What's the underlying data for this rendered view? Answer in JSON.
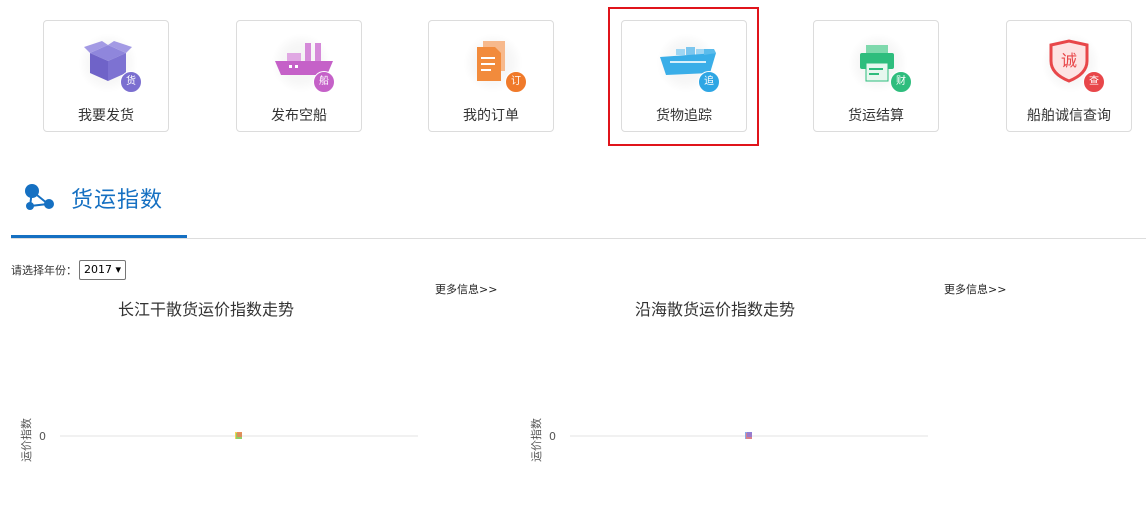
{
  "tiles": [
    {
      "label": "我要发货",
      "badge": "货",
      "icon": "box-icon",
      "color": "#7b6fd0"
    },
    {
      "label": "发布空船",
      "badge": "船",
      "icon": "empty-ship-icon",
      "color": "#c561c8"
    },
    {
      "label": "我的订单",
      "badge": "订",
      "icon": "order-document-icon",
      "color": "#f07a2a"
    },
    {
      "label": "货物追踪",
      "badge": "追",
      "icon": "cargo-ship-icon",
      "color": "#2ea6e4"
    },
    {
      "label": "货运结算",
      "badge": "财",
      "icon": "printer-icon",
      "color": "#2ebd7d"
    },
    {
      "label": "船舶诚信查询",
      "badge": "查",
      "icon": "shield-search-icon",
      "color": "#e8474a"
    }
  ],
  "section": {
    "title": "货运指数",
    "icon": "network-nodes-icon",
    "accent": "#1570c2"
  },
  "year_filter": {
    "label": "请选择年份：",
    "value": "2017"
  },
  "more_link": "更多信息>>",
  "charts": [
    {
      "title": "长江干散货运价指数走势",
      "more": "更多信息>>"
    },
    {
      "title": "沿海散货运价指数走势",
      "more": "更多信息>>"
    }
  ],
  "chart_data": [
    {
      "type": "line",
      "title": "长江干散货运价指数走势",
      "ylabel": "运价指数",
      "xlabel": "",
      "y_ticks": [
        "0"
      ],
      "series": [
        {
          "values": [
            0
          ]
        }
      ]
    },
    {
      "type": "line",
      "title": "沿海散货运价指数走势",
      "ylabel": "运价指数",
      "xlabel": "",
      "y_ticks": [
        "0"
      ],
      "series": [
        {
          "values": [
            0
          ]
        }
      ]
    }
  ]
}
